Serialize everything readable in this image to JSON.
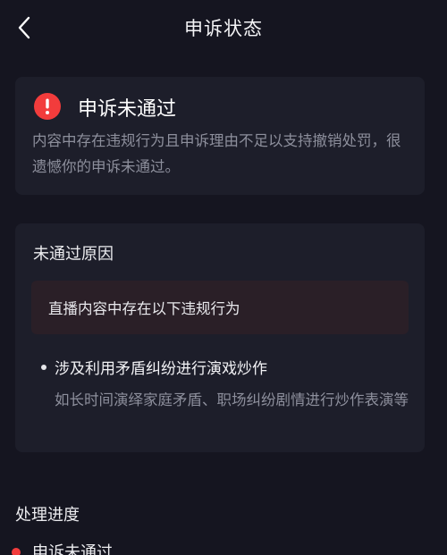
{
  "header": {
    "title": "申诉状态",
    "back_icon": "chevron-left-icon"
  },
  "status_card": {
    "icon": "alert-circle-icon",
    "icon_color": "#f23c3c",
    "title": "申诉未通过",
    "description": "内容中存在违规行为且申诉理由不足以支持撤销处罚，很遗憾你的申诉未通过。"
  },
  "reason_card": {
    "heading": "未通过原因",
    "violation_summary": "直播内容中存在以下违规行为",
    "items": [
      {
        "title": "涉及利用矛盾纠纷进行演戏炒作",
        "description": "如长时间演绎家庭矛盾、职场纠纷剧情进行炒作表演等"
      }
    ]
  },
  "progress": {
    "heading": "处理进度",
    "steps": [
      {
        "label": "申诉未通过",
        "color": "#f23c3c"
      }
    ]
  }
}
